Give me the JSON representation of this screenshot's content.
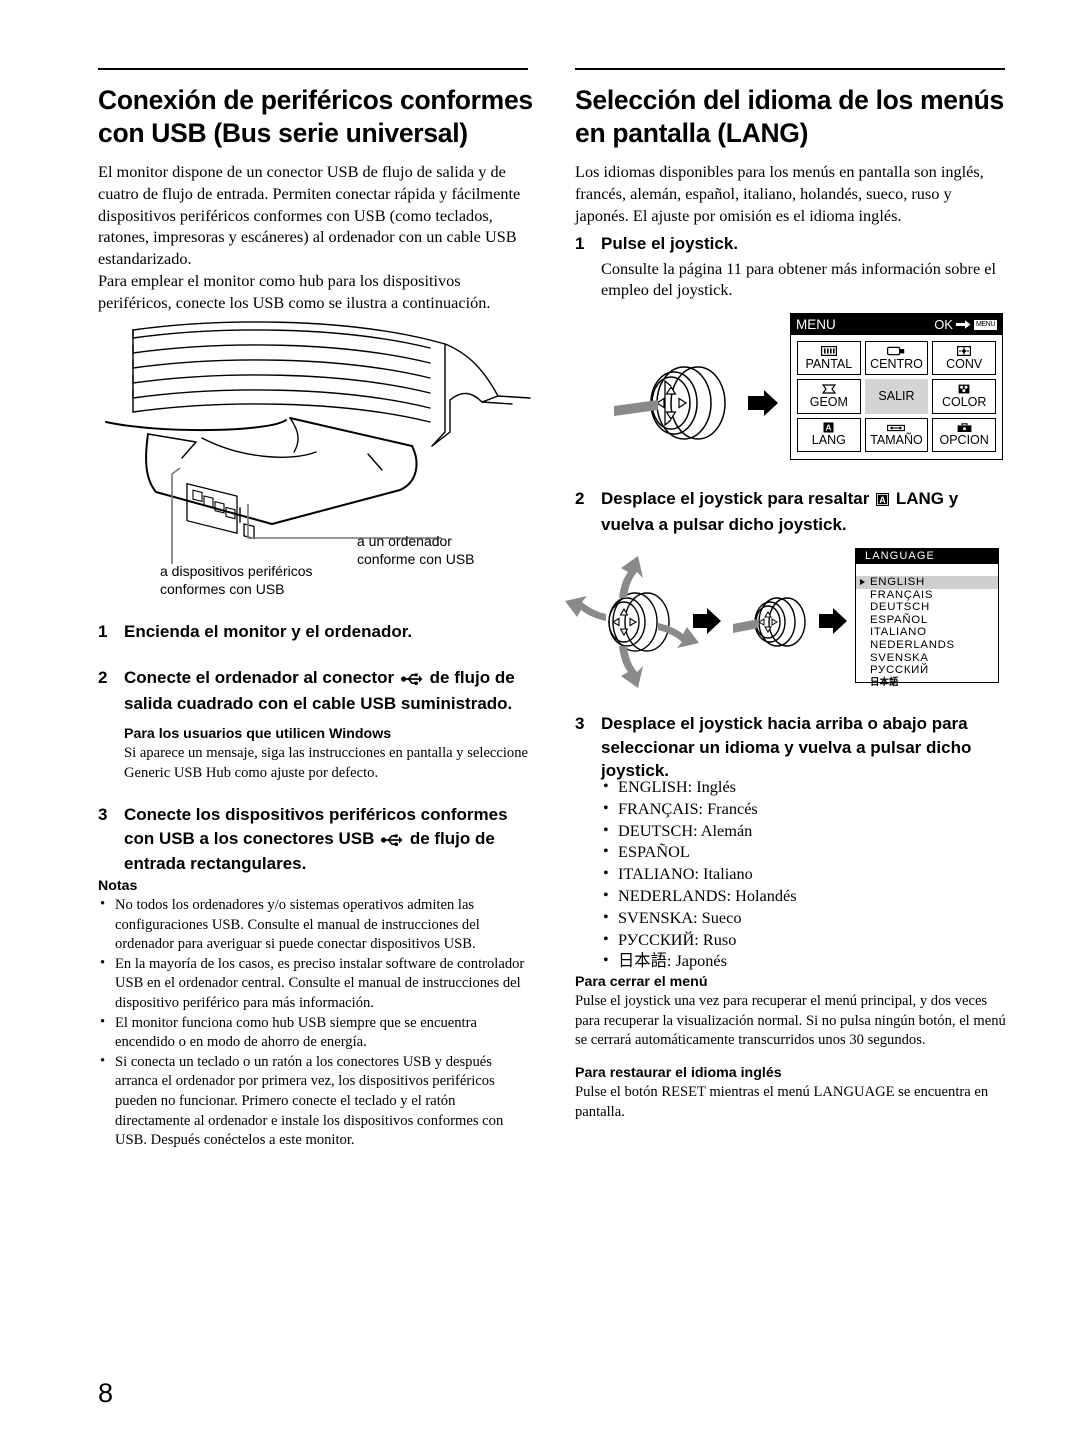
{
  "page_number": "8",
  "left_column": {
    "title": "Conexión de periféricos conformes con USB (Bus serie universal)",
    "intro_p1": "El monitor dispone de un conector USB de flujo de salida y de cuatro de flujo de entrada. Permiten conectar rápida y fácilmente dispositivos periféricos conformes con USB (como teclados, ratones, impresoras y escáneres) al ordenador con un cable USB estandarizado.",
    "intro_p2": "Para emplear el monitor como hub para los dispositivos periféricos, conecte los USB como se ilustra a continuación.",
    "figure": {
      "callout_computer": "a un ordenador\nconforme con USB",
      "callout_computer_line1": "a un ordenador",
      "callout_computer_line2": "conforme con USB",
      "callout_devices_line1": "a dispositivos periféricos",
      "callout_devices_line2": "conformes con USB"
    },
    "steps": [
      {
        "num": "1",
        "text": "Encienda el monitor y el ordenador."
      },
      {
        "num": "2",
        "text_before_icon": "Conecte el ordenador al conector",
        "icon": "usb-icon",
        "text_after_icon": "de flujo de salida cuadrado con el cable USB suministrado.",
        "note_heading": "Para los usuarios que utilicen Windows",
        "note_body": "Si aparece un mensaje, siga las instrucciones en pantalla y seleccione Generic USB Hub como ajuste por defecto."
      },
      {
        "num": "3",
        "text_before_icon": "Conecte los dispositivos periféricos conformes con USB a los conectores USB",
        "icon": "usb-icon",
        "text_after_icon": "de flujo de entrada rectangulares."
      }
    ],
    "notes_heading": "Notas",
    "notes": [
      "No todos los ordenadores y/o sistemas operativos admiten las configuraciones USB. Consulte el manual de instrucciones del ordenador para averiguar si puede conectar dispositivos USB.",
      "En la mayoría de los casos, es preciso instalar software de controlador USB en el ordenador central. Consulte el manual de instrucciones del dispositivo periférico para más información.",
      "El monitor funciona como hub USB siempre que se encuentra encendido o en modo de ahorro de energía.",
      "Si conecta un teclado o un ratón a los conectores USB y después arranca el ordenador por primera vez, los dispositivos periféricos pueden no funcionar. Primero conecte el teclado y el ratón directamente al ordenador e instale los dispositivos conformes con USB. Después conéctelos a este monitor."
    ]
  },
  "right_column": {
    "title": "Selección del idioma de los menús en pantalla (LANG)",
    "intro": "Los idiomas disponibles para los menús en pantalla son inglés, francés, alemán, español, italiano, holandés, sueco, ruso y japonés. El ajuste por omisión es el idioma inglés.",
    "steps": [
      {
        "num": "1",
        "text": "Pulse el joystick.",
        "sub": "Consulte la página 11 para obtener más información sobre el empleo del joystick."
      },
      {
        "num": "2",
        "text_before_icon": "Desplace el joystick para resaltar",
        "icon": "lang-icon",
        "text_after_icon": "LANG y vuelva a pulsar dicho joystick."
      },
      {
        "num": "3",
        "text": "Desplace el joystick hacia arriba o abajo para seleccionar un idioma y vuelva a pulsar dicho joystick."
      }
    ],
    "language_bullets": [
      "ENGLISH: Inglés",
      "FRANÇAIS: Francés",
      "DEUTSCH: Alemán",
      "ESPAÑOL",
      "ITALIANO: Italiano",
      "NEDERLANDS: Holandés",
      "SVENSKA: Sueco",
      "РУССКИЙ: Ruso",
      "日本語: Japonés"
    ],
    "close_menu_heading": "Para cerrar el menú",
    "close_menu_body": "Pulse el joystick una vez para recuperar el menú principal, y dos veces para recuperar la visualización normal. Si no pulsa ningún botón, el menú se cerrará automáticamente transcurridos unos 30 segundos.",
    "restore_heading": "Para restaurar el idioma inglés",
    "restore_body": "Pulse el botón RESET mientras el menú LANGUAGE se encuentra en pantalla.",
    "osd_menu": {
      "title": "MENU",
      "ok_label": "OK",
      "ok_badge": "MENU",
      "cells": [
        {
          "label": "PANTAL",
          "icon": "screen-icon",
          "selected": false
        },
        {
          "label": "CENTRO",
          "icon": "center-icon",
          "selected": false
        },
        {
          "label": "CONV",
          "icon": "convergence-icon",
          "selected": false
        },
        {
          "label": "GEOM",
          "icon": "geometry-icon",
          "selected": false
        },
        {
          "label": "SALIR",
          "icon": "none",
          "selected": true
        },
        {
          "label": "COLOR",
          "icon": "color-icon",
          "selected": false
        },
        {
          "label": "LANG",
          "icon": "lang-icon",
          "selected": false
        },
        {
          "label": "TAMAÑO",
          "icon": "size-icon",
          "selected": false
        },
        {
          "label": "OPCION",
          "icon": "option-icon",
          "selected": false
        }
      ]
    },
    "language_osd": {
      "title": "LANGUAGE",
      "items": [
        {
          "label": "ENGLISH",
          "selected": true
        },
        {
          "label": "FRANÇAIS",
          "selected": false
        },
        {
          "label": "DEUTSCH",
          "selected": false
        },
        {
          "label": "ESPAÑOL",
          "selected": false
        },
        {
          "label": "ITALIANO",
          "selected": false
        },
        {
          "label": "NEDERLANDS",
          "selected": false
        },
        {
          "label": "SVENSKA",
          "selected": false
        },
        {
          "label": "РУССКИЙ",
          "selected": false
        },
        {
          "label": "日本語",
          "selected": false
        }
      ]
    }
  }
}
